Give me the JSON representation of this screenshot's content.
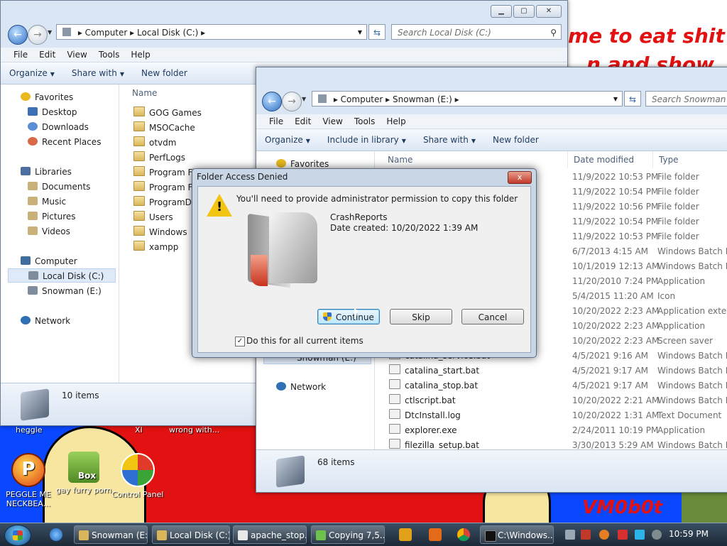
{
  "wallpaper": {
    "scrawl_line1": "me to eat shit",
    "scrawl_line2": "n and show",
    "brand": "VM0b0t"
  },
  "desktop_icons": [
    {
      "label": "PEGGLE ME NECKBEA...",
      "icon": "peggle-icon"
    },
    {
      "label": "gay furry porn",
      "icon": "box-icon",
      "badge": "Box"
    },
    {
      "label": "Control Panel",
      "icon": "control-panel-icon"
    }
  ],
  "desktop_top_labels": [
    "heggle",
    "XI",
    "wrong with..."
  ],
  "window_local": {
    "breadcrumb": [
      "Computer",
      "Local Disk (C:)"
    ],
    "search_placeholder": "Search Local Disk (C:)",
    "menu": [
      "File",
      "Edit",
      "View",
      "Tools",
      "Help"
    ],
    "commands": [
      "Organize",
      "Share with",
      "New folder"
    ],
    "nav": {
      "favorites": "Favorites",
      "favorites_items": [
        "Desktop",
        "Downloads",
        "Recent Places"
      ],
      "libraries": "Libraries",
      "libraries_items": [
        "Documents",
        "Music",
        "Pictures",
        "Videos"
      ],
      "computer": "Computer",
      "computer_items": [
        "Local Disk (C:)",
        "Snowman (E:)"
      ],
      "network": "Network"
    },
    "column_name": "Name",
    "files": [
      "GOG Games",
      "MSOCache",
      "otvdm",
      "PerfLogs",
      "Program Files",
      "Program Files",
      "ProgramData",
      "Users",
      "Windows",
      "xampp"
    ],
    "status": "10 items"
  },
  "window_snowman": {
    "breadcrumb": [
      "Computer",
      "Snowman (E:)"
    ],
    "search_placeholder": "Search Snowman (E:)",
    "menu": [
      "File",
      "Edit",
      "View",
      "Tools",
      "Help"
    ],
    "commands": [
      "Organize",
      "Include in library",
      "Share with",
      "New folder"
    ],
    "nav": {
      "favorites": "Favorites",
      "snowman": "Snowman (E:)",
      "network": "Network"
    },
    "columns": [
      "Name",
      "Date modified",
      "Type"
    ],
    "rows": [
      {
        "name": "",
        "date": "11/9/2022 10:53 PM",
        "type": "File folder"
      },
      {
        "name": "",
        "date": "11/9/2022 10:54 PM",
        "type": "File folder"
      },
      {
        "name": "",
        "date": "11/9/2022 10:56 PM",
        "type": "File folder"
      },
      {
        "name": "",
        "date": "11/9/2022 10:54 PM",
        "type": "File folder"
      },
      {
        "name": "",
        "date": "11/9/2022 10:53 PM",
        "type": "File folder"
      },
      {
        "name": "",
        "date": "6/7/2013 4:15 AM",
        "type": "Windows Batch File"
      },
      {
        "name": "",
        "date": "10/1/2019 12:13 AM",
        "type": "Windows Batch File"
      },
      {
        "name": "",
        "date": "11/20/2010 7:24 PM",
        "type": "Application"
      },
      {
        "name": "",
        "date": "5/4/2015 11:20 AM",
        "type": "Icon"
      },
      {
        "name": "",
        "date": "10/20/2022 2:23 AM",
        "type": "Application extens..."
      },
      {
        "name": "",
        "date": "10/20/2022 2:23 AM",
        "type": "Application"
      },
      {
        "name": "",
        "date": "10/20/2022 2:23 AM",
        "type": "Screen saver"
      },
      {
        "name": "catalina_service.bat",
        "date": "4/5/2021 9:16 AM",
        "type": "Windows Batch File"
      },
      {
        "name": "catalina_start.bat",
        "date": "4/5/2021 9:17 AM",
        "type": "Windows Batch File"
      },
      {
        "name": "catalina_stop.bat",
        "date": "4/5/2021 9:17 AM",
        "type": "Windows Batch File"
      },
      {
        "name": "ctlscript.bat",
        "date": "10/20/2022 2:21 AM",
        "type": "Windows Batch File"
      },
      {
        "name": "DtcInstall.log",
        "date": "10/20/2022 1:31 AM",
        "type": "Text Document"
      },
      {
        "name": "explorer.exe",
        "date": "2/24/2011 10:19 PM",
        "type": "Application"
      },
      {
        "name": "filezilla_setup.bat",
        "date": "3/30/2013 5:29 AM",
        "type": "Windows Batch File"
      }
    ],
    "status": "68 items"
  },
  "dialog": {
    "title": "Folder Access Denied",
    "close": "x",
    "message": "You'll need to provide administrator permission to copy this folder",
    "folder_name": "CrashReports",
    "date_created": "Date created: 10/20/2022 1:39 AM",
    "btn_continue": "Continue",
    "btn_skip": "Skip",
    "btn_cancel": "Cancel",
    "checkbox_label": "Do this for all current items",
    "checkbox_checked": "✓"
  },
  "taskbar": {
    "items": [
      "Snowman (E:)",
      "Local Disk (C:)",
      "apache_stop...",
      "Copying 7,5...",
      "C:\\Windows..."
    ],
    "clock": "10:59 PM"
  }
}
